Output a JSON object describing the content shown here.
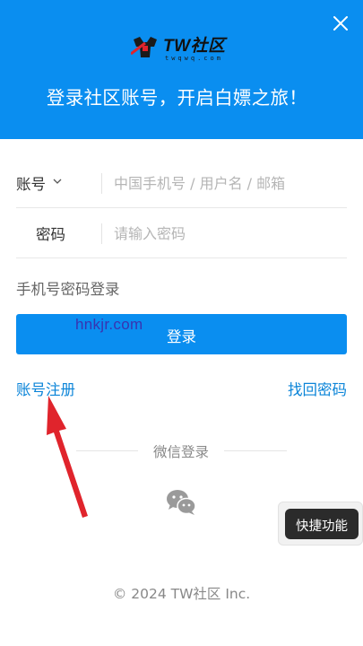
{
  "header": {
    "brand_name": "TW社区",
    "brand_domain": "twqwq.com",
    "slogan": "登录社区账号，开启白嫖之旅！",
    "background_color": "#0a8ef0"
  },
  "form": {
    "account_label": "账号",
    "account_placeholder": "中国手机号 / 用户名 / 邮箱",
    "account_value": "",
    "password_label": "密码",
    "password_placeholder": "请输入密码",
    "password_value": "",
    "switch_mode": "手机号密码登录",
    "login_button": "登录",
    "watermark": "hnkjr.com"
  },
  "links": {
    "register": "账号注册",
    "forgot_password": "找回密码"
  },
  "social": {
    "divider_label": "微信登录",
    "icon": "wechat-icon"
  },
  "floating": {
    "quick_actions": "快捷功能"
  },
  "footer": {
    "copyright": "© 2024 TW社区 Inc."
  },
  "annotation": {
    "arrow_color": "#e0242c",
    "points_to": "register"
  }
}
